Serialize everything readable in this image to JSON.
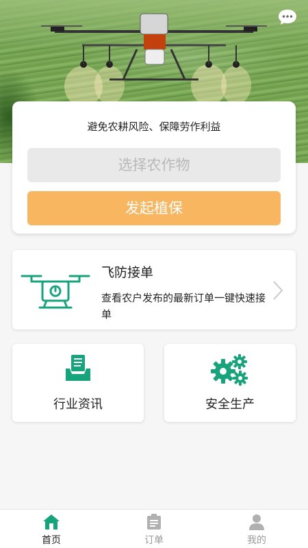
{
  "hero": {
    "image_alt": "agricultural spraying drone over tea field",
    "chat_icon": "chat-bubble-icon"
  },
  "card": {
    "slogan": "避免农耕风险、保障劳作利益",
    "crop_select_placeholder": "选择农作物",
    "start_button": "发起植保"
  },
  "flight": {
    "title": "飞防接单",
    "description": "查看农户发布的最新订单一键快速接单",
    "icon": "drone-icon"
  },
  "tiles": [
    {
      "label": "行业资讯",
      "icon": "news-inbox-icon"
    },
    {
      "label": "安全生产",
      "icon": "gears-icon"
    }
  ],
  "tabbar": {
    "items": [
      {
        "label": "首页",
        "icon": "home-icon",
        "active": true
      },
      {
        "label": "订单",
        "icon": "order-list-icon",
        "active": false
      },
      {
        "label": "我的",
        "icon": "user-icon",
        "active": false
      }
    ]
  },
  "colors": {
    "accent_green": "#16a47c",
    "button_orange": "#f8b660",
    "input_gray": "#e9e9e9"
  }
}
